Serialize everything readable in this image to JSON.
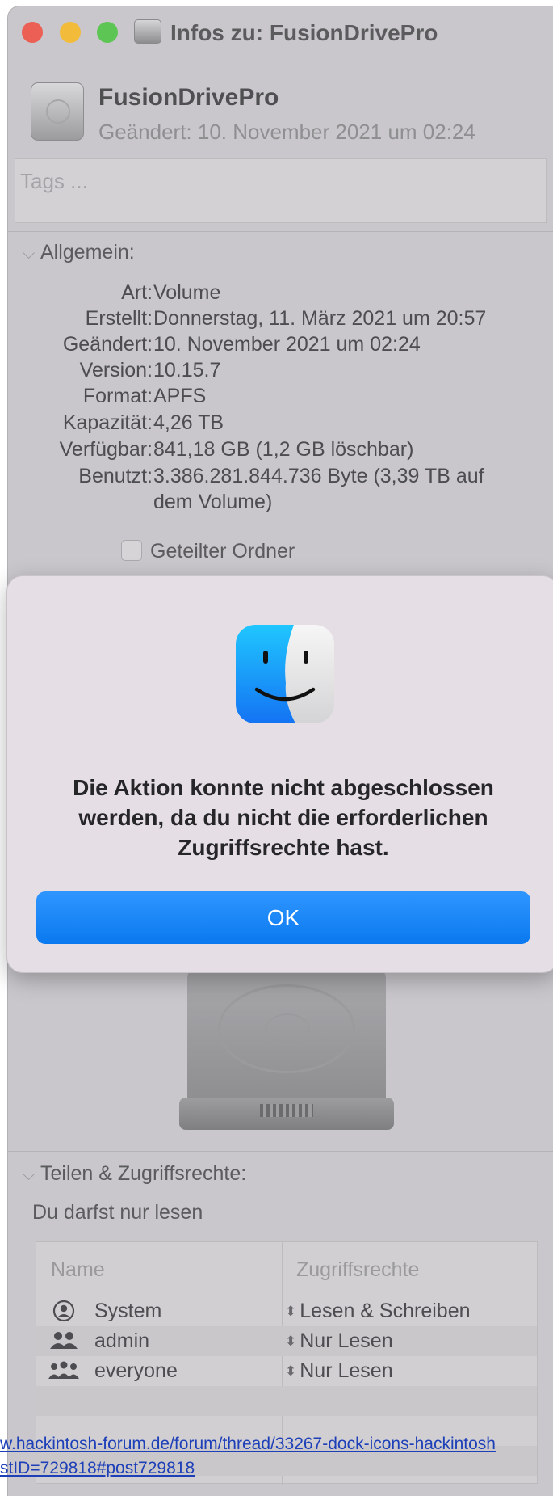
{
  "window": {
    "title": "Infos zu: FusionDrivePro"
  },
  "header": {
    "name": "FusionDrivePro",
    "modified": "Geändert: 10. November 2021 um 02:24"
  },
  "tags": {
    "placeholder": "Tags ..."
  },
  "general": {
    "heading": "Allgemein:",
    "rows": [
      {
        "label": "Art:",
        "value": "Volume"
      },
      {
        "label": "Erstellt:",
        "value": "Donnerstag, 11. März 2021 um 20:57"
      },
      {
        "label": "Geändert:",
        "value": "10. November 2021 um 02:24"
      },
      {
        "label": "Version:",
        "value": "10.15.7"
      },
      {
        "label": "Format:",
        "value": "APFS"
      },
      {
        "label": "Kapazität:",
        "value": "4,26 TB"
      },
      {
        "label": "Verfügbar:",
        "value": "841,18 GB (1,2 GB löschbar)"
      },
      {
        "label": "Benutzt:",
        "value": "3.386.281.844.736 Byte (3,39 TB auf"
      },
      {
        "label": "",
        "value": "dem Volume)"
      }
    ],
    "shared_folder": "Geteilter Ordner"
  },
  "dialog": {
    "icon": "finder-icon",
    "message_lines": [
      "Die Aktion konnte nicht abgeschlossen",
      "werden, da du nicht die erforderlichen",
      "Zugriffsrechte hast."
    ],
    "ok_label": "OK",
    "button_color": "#0a7cf2"
  },
  "sharing": {
    "heading": "Teilen & Zugriffsrechte:",
    "description": "Du darfst nur lesen",
    "columns": [
      "Name",
      "Zugriffsrechte"
    ],
    "rows": [
      {
        "icon": "user-circle-icon",
        "name": "System",
        "rights": "Lesen & Schreiben"
      },
      {
        "icon": "group-icon",
        "name": "admin",
        "rights": "Nur Lesen"
      },
      {
        "icon": "everyone-icon",
        "name": "everyone",
        "rights": "Nur Lesen"
      }
    ]
  },
  "overlay_url": {
    "line1": "w.hackintosh-forum.de/forum/thread/33267-dock-icons-hackintosh",
    "line2": "stID=729818#post729818"
  }
}
